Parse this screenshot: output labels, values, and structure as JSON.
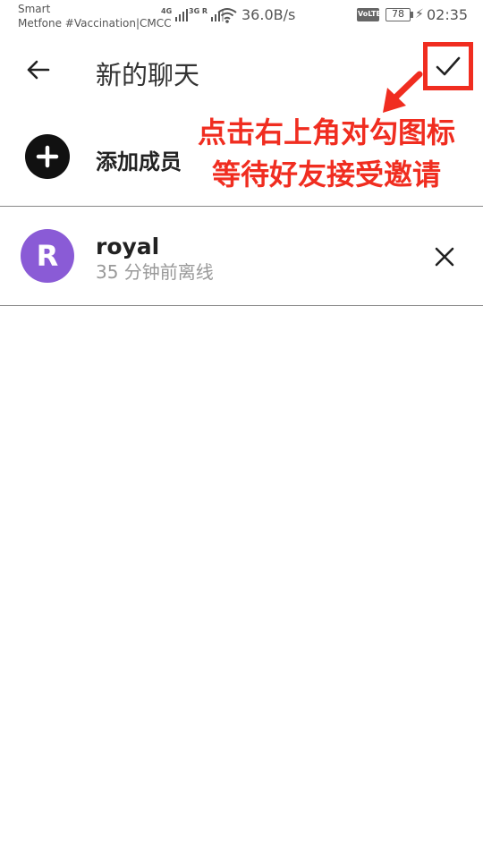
{
  "status_bar": {
    "carrier_line1": "Smart",
    "carrier_line2": "Metfone #Vaccination|CMCC",
    "net1_label": "4G",
    "net2_label": "3G R",
    "speed": "36.0B/s",
    "volte": "VoLTE",
    "battery": "78",
    "time": "02:35"
  },
  "header": {
    "title": "新的聊天",
    "back_icon": "arrow-left-icon",
    "confirm_icon": "checkmark-icon"
  },
  "annotation": {
    "line1": "点击右上角对勾图标",
    "line2": "等待好友接受邀请",
    "color": "#f02d20"
  },
  "add_member": {
    "label": "添加成员",
    "icon": "plus-circle-icon"
  },
  "members": [
    {
      "initial": "R",
      "name": "royal",
      "status": "35 分钟前离线",
      "avatar_color": "#8a5bd6",
      "remove_icon": "close-icon"
    }
  ]
}
